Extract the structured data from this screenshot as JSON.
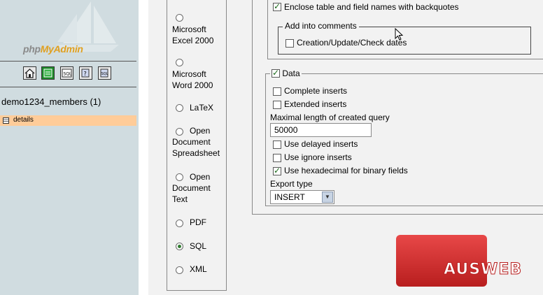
{
  "app": {
    "logo_prefix": "php",
    "logo_brand": "MyAdmin"
  },
  "sidebar": {
    "toolbar_icons": [
      "home-icon",
      "query-window-icon",
      "sql-icon",
      "documentation-icon",
      "sql-docs-icon"
    ],
    "database_title": "demo1234_members (1)",
    "tables": [
      {
        "label": "details",
        "icon": "table-icon"
      }
    ]
  },
  "export_formats": [
    {
      "label": "Microsoft Excel 2000",
      "lines": [
        "Microsoft",
        "Excel 2000"
      ],
      "selected": false
    },
    {
      "label": "Microsoft Word 2000",
      "lines": [
        "Microsoft",
        "Word 2000"
      ],
      "selected": false
    },
    {
      "label": "LaTeX",
      "lines": [
        "LaTeX"
      ],
      "selected": false
    },
    {
      "label": "Open Document Spreadsheet",
      "lines": [
        "Open",
        "Document",
        "Spreadsheet"
      ],
      "selected": false
    },
    {
      "label": "Open Document Text",
      "lines": [
        "Open",
        "Document",
        "Text"
      ],
      "selected": false
    },
    {
      "label": "PDF",
      "lines": [
        "PDF"
      ],
      "selected": false
    },
    {
      "label": "SQL",
      "lines": [
        "SQL"
      ],
      "selected": true
    },
    {
      "label": "XML",
      "lines": [
        "XML"
      ],
      "selected": false
    }
  ],
  "structure": {
    "backquotes_label": "Enclose table and field names with backquotes",
    "backquotes_checked": true,
    "comments_legend": "Add into comments",
    "dates_label": "Creation/Update/Check dates",
    "dates_checked": false
  },
  "data_section": {
    "legend": "Data",
    "enabled": true,
    "complete_inserts_label": "Complete inserts",
    "complete_inserts_checked": false,
    "extended_inserts_label": "Extended inserts",
    "extended_inserts_checked": false,
    "max_length_label": "Maximal length of created query",
    "max_length_value": "50000",
    "delayed_inserts_label": "Use delayed inserts",
    "delayed_inserts_checked": false,
    "ignore_inserts_label": "Use ignore inserts",
    "ignore_inserts_checked": false,
    "hex_binary_label": "Use hexadecimal for binary fields",
    "hex_binary_checked": true,
    "export_type_label": "Export type",
    "export_type_value": "INSERT"
  },
  "watermark": {
    "text": "AUSWEB"
  },
  "colors": {
    "sidebar_bg": "#D0DCE0",
    "selected_table_bg": "#FFCC99",
    "main_bg": "#F2F2F2",
    "watermark_red": "#D42C2C"
  }
}
